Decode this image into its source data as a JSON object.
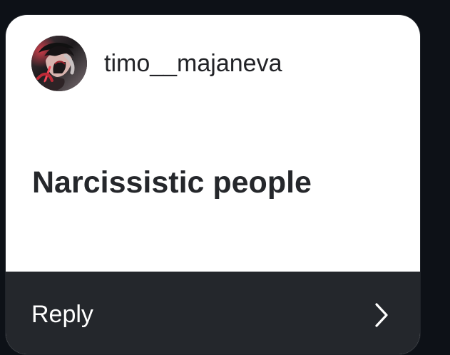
{
  "card": {
    "username": "timo__majaneva",
    "message": "Narcissistic people",
    "reply_label": "Reply",
    "avatar_icon": "avatar",
    "reply_icon": "chevron-right-icon"
  },
  "colors": {
    "page_background": "#0d1117",
    "card_background": "#ffffff",
    "reply_background": "#24272c",
    "text_dark": "#222327",
    "text_light": "#ffffff"
  }
}
